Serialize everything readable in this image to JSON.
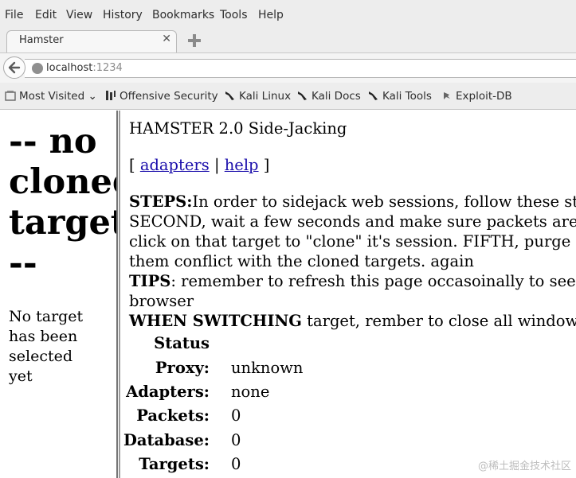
{
  "menu": [
    "File",
    "Edit",
    "View",
    "History",
    "Bookmarks",
    "Tools",
    "Help"
  ],
  "tab": {
    "title": "Hamster",
    "close": "✕"
  },
  "url": {
    "host": "localhost",
    "port": ":1234"
  },
  "bookmarks": [
    "Most Visited",
    "Offensive Security",
    "Kali Linux",
    "Kali Docs",
    "Kali Tools",
    "Exploit-DB"
  ],
  "left": {
    "heading_lines": [
      "-- no",
      "cloned",
      "target",
      "--"
    ],
    "message_lines": [
      "No target",
      "has been",
      "selected",
      "yet"
    ]
  },
  "right": {
    "title": "HAMSTER 2.0 Side-Jacking",
    "links": {
      "open": "[",
      "adapters": "adapters",
      "sep": "|",
      "help": "help",
      "close": "]"
    },
    "steps_label": "STEPS:",
    "steps_lines": [
      "In order to sidejack web sessions, follow these steps.",
      "SECOND, wait a few seconds and make sure packets are being received.",
      "click on that target to \"clone\" it's session. FIFTH, purge cookies",
      "them conflict with the cloned targets. again"
    ],
    "tips_label": "TIPS",
    "tips_lines": [
      ": remember to refresh this page occasoinally to see updates",
      "browser"
    ],
    "switch_label": "WHEN SWITCHING",
    "switch_text": " target, rember to close all windows",
    "status_heading": "Status",
    "stats": [
      {
        "label": "Proxy:",
        "value": "unknown"
      },
      {
        "label": "Adapters:",
        "value": "none"
      },
      {
        "label": "Packets:",
        "value": "0"
      },
      {
        "label": "Database:",
        "value": "0"
      },
      {
        "label": "Targets:",
        "value": "0"
      }
    ]
  },
  "watermark": "@稀土掘金技术社区",
  "colors": {
    "link": "#1a0dab",
    "chrome": "#ededed"
  }
}
